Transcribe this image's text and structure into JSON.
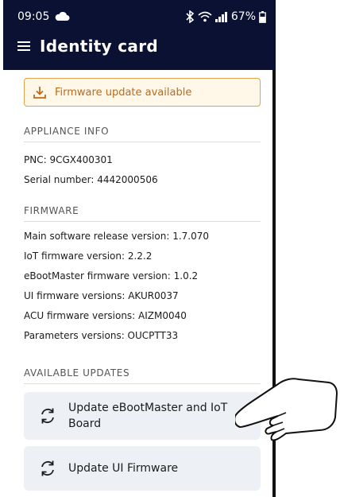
{
  "status_bar": {
    "time": "09:05",
    "battery": "67%"
  },
  "appbar": {
    "title": "Identity card"
  },
  "banner": {
    "text": "Firmware update available"
  },
  "appliance_info": {
    "heading": "APPLIANCE INFO",
    "pnc": "PNC: 9CGX400301",
    "serial": "Serial number: 4442000506"
  },
  "firmware": {
    "heading": "FIRMWARE",
    "lines": [
      "Main software release version: 1.7.070",
      "IoT firmware version: 2.2.2",
      "eBootMaster firmware version: 1.0.2",
      "UI firmware versions: AKUR0037",
      "ACU firmware versions: AIZM0040",
      "Parameters versions: OUCPTT33"
    ]
  },
  "available_updates": {
    "heading": "AVAILABLE UPDATES",
    "buttons": [
      {
        "label_line1": "Update eBootMaster and IoT",
        "label_line2": "Board"
      },
      {
        "label": "Update UI Firmware"
      }
    ]
  },
  "colors": {
    "appbar_bg": "#0b1133",
    "banner_border": "#e1a24b",
    "banner_text": "#c06a16",
    "button_bg": "#edf1f5"
  },
  "icons": [
    "cloud-icon",
    "bluetooth-icon",
    "wifi-icon",
    "signal-icon",
    "battery-icon",
    "menu-icon",
    "download-icon",
    "refresh-icon",
    "pointing-hand-icon"
  ]
}
